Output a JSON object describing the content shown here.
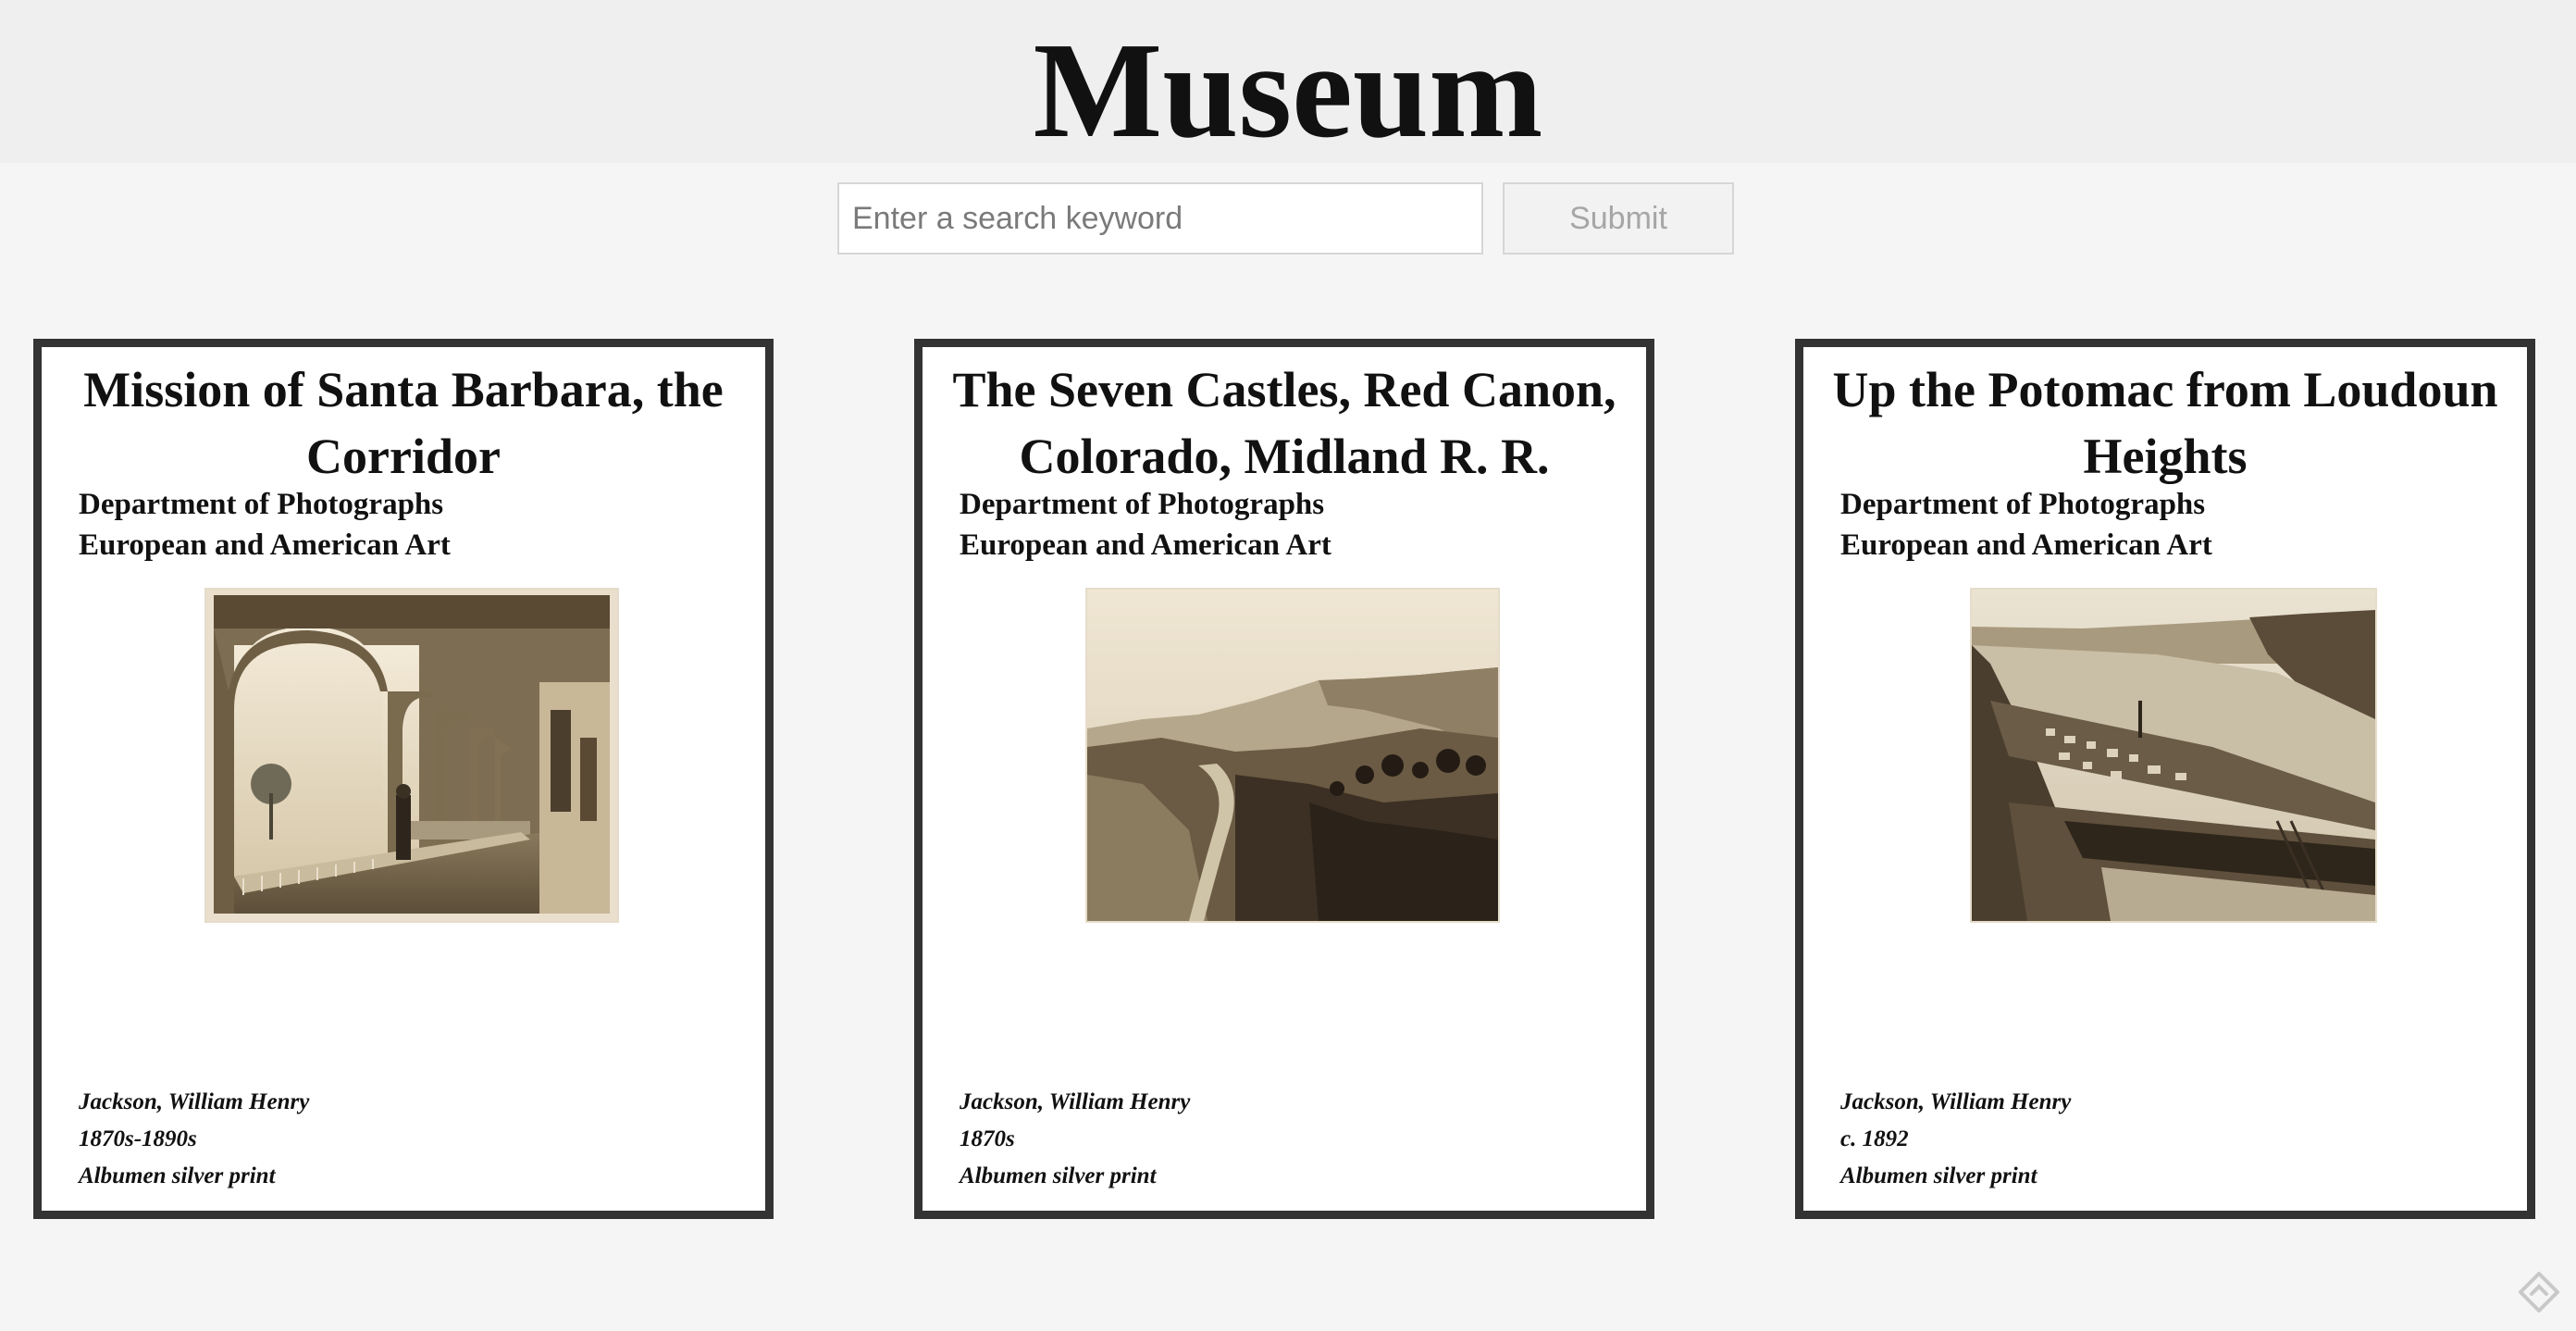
{
  "header": {
    "title": "Museum"
  },
  "search": {
    "placeholder": "Enter a search keyword",
    "value": "",
    "submit_label": "Submit"
  },
  "cards": [
    {
      "title": "Mission of Santa Barbara, the Corridor",
      "department_line1": "Department of Photographs",
      "department_line2": "European and American Art",
      "artist": "Jackson, William Henry",
      "date": "1870s-1890s",
      "medium": "Albumen silver print",
      "image_icon": "arched-corridor-photo"
    },
    {
      "title": "The Seven Castles, Red Canon, Colorado, Midland R. R.",
      "department_line1": "Department of Photographs",
      "department_line2": "European and American Art",
      "artist": "Jackson, William Henry",
      "date": "1870s",
      "medium": "Albumen silver print",
      "image_icon": "canyon-landscape-photo"
    },
    {
      "title": "Up the Potomac from Loudoun Heights",
      "department_line1": "Department of Photographs",
      "department_line2": "European and American Art",
      "artist": "Jackson, William Henry",
      "date": "c. 1892",
      "medium": "Albumen silver print",
      "image_icon": "river-town-photo"
    }
  ],
  "colors": {
    "page_background": "#f5f5f5",
    "header_background": "#efefef",
    "card_border": "#333333",
    "photo_sepia": "#a89a7e"
  }
}
